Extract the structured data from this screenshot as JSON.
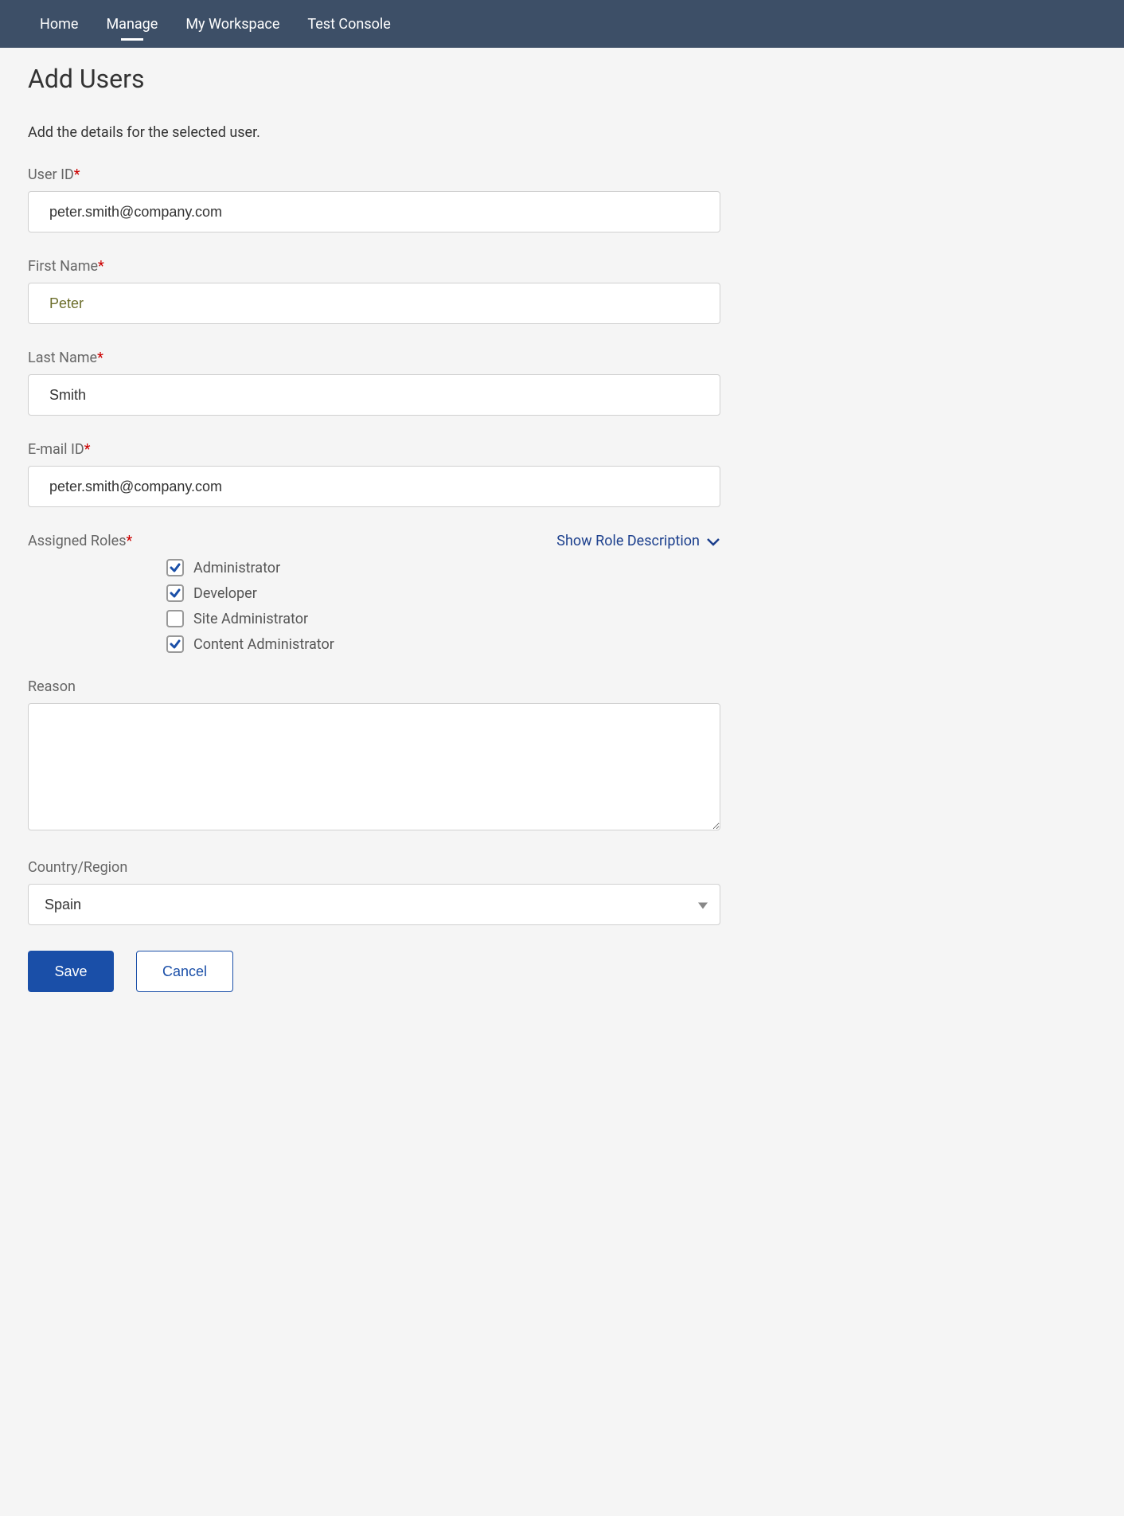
{
  "nav": {
    "items": [
      {
        "label": "Home"
      },
      {
        "label": "Manage"
      },
      {
        "label": "My Workspace"
      },
      {
        "label": "Test Console"
      }
    ],
    "active_index": 1
  },
  "page": {
    "title": "Add Users",
    "subtitle": "Add the details for the selected user."
  },
  "form": {
    "user_id": {
      "label": "User ID",
      "required": true,
      "value": "peter.smith@company.com"
    },
    "first_name": {
      "label": "First Name",
      "required": true,
      "value": "Peter"
    },
    "last_name": {
      "label": "Last Name",
      "required": true,
      "value": "Smith"
    },
    "email_id": {
      "label": "E-mail ID",
      "required": true,
      "value": "peter.smith@company.com"
    },
    "assigned_roles": {
      "label": "Assigned Roles",
      "required": true,
      "show_description_label": "Show Role Description",
      "options": [
        {
          "label": "Administrator",
          "checked": true
        },
        {
          "label": "Developer",
          "checked": true
        },
        {
          "label": "Site Administrator",
          "checked": false
        },
        {
          "label": "Content Administrator",
          "checked": true
        }
      ]
    },
    "reason": {
      "label": "Reason",
      "value": ""
    },
    "country_region": {
      "label": "Country/Region",
      "value": "Spain"
    }
  },
  "buttons": {
    "save": "Save",
    "cancel": "Cancel"
  },
  "required_marker": "*"
}
